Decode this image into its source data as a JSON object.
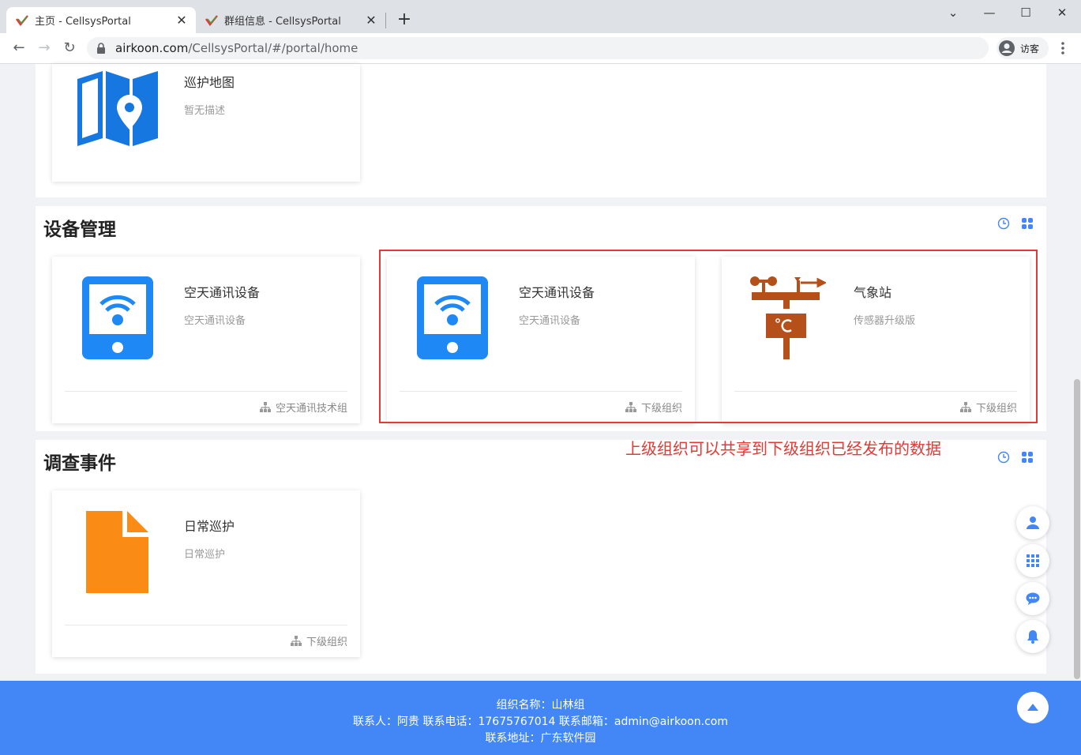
{
  "browser": {
    "tabs": [
      {
        "title": "主页 - CellsysPortal",
        "active": true
      },
      {
        "title": "群组信息 - CellsysPortal",
        "active": false
      }
    ],
    "url_host": "airkoon.com",
    "url_path": "/CellsysPortal/#/portal/home",
    "profile_label": "访客"
  },
  "top_card": {
    "title": "巡护地图",
    "desc": "暂无描述"
  },
  "device_section": {
    "title": "设备管理",
    "cards": [
      {
        "title": "空天通讯设备",
        "desc": "空天通讯设备",
        "footer": "空天通讯技术组"
      },
      {
        "title": "空天通讯设备",
        "desc": "空天通讯设备",
        "footer": "下级组织"
      },
      {
        "title": "气象站",
        "desc": "传感器升级版",
        "footer": "下级组织"
      }
    ]
  },
  "annotation": "上级组织可以共享到下级组织已经发布的数据",
  "survey_section": {
    "title": "调查事件",
    "cards": [
      {
        "title": "日常巡护",
        "desc": "日常巡护",
        "footer": "下级组织"
      }
    ]
  },
  "footer": {
    "org_name": "组织名称：山林组",
    "contact": "联系人：阿贵   联系电话：17675767014   联系邮箱：admin@airkoon.com",
    "address": "联系地址：广东软件园"
  },
  "colors": {
    "accent": "#4287f5",
    "device_blue": "#1e88f5",
    "weather_brown": "#b5501a",
    "file_orange": "#fa8c16",
    "annotation_red": "#e53935"
  }
}
